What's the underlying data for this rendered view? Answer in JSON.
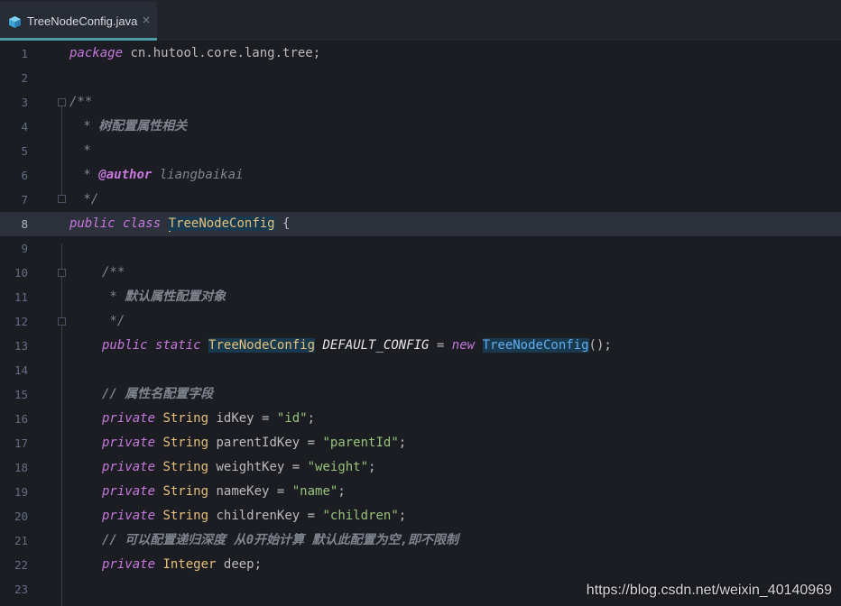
{
  "tab": {
    "filename": "TreeNodeConfig.java",
    "close_glyph": "×",
    "icon": "java-class-icon"
  },
  "line_numbers": [
    "1",
    "2",
    "3",
    "4",
    "5",
    "6",
    "7",
    "8",
    "9",
    "10",
    "11",
    "12",
    "13",
    "14",
    "15",
    "16",
    "17",
    "18",
    "19",
    "20",
    "21",
    "22",
    "23"
  ],
  "current_line": 8,
  "code": {
    "l1": {
      "kw": "package",
      "rest": " cn.hutool.core.lang.tree;"
    },
    "l3": {
      "text": "/**"
    },
    "l4": {
      "star": " * ",
      "text": "树配置属性相关"
    },
    "l5": {
      "text": " *"
    },
    "l6": {
      "star": " * ",
      "tag": "@author",
      "rest": " liangbaikai"
    },
    "l7": {
      "text": " */"
    },
    "l8": {
      "kw1": "public",
      "kw2": "class",
      "name": "TreeNodeConfig",
      "brace": " {"
    },
    "l10": {
      "text": "/**"
    },
    "l11": {
      "star": " * ",
      "text": "默认属性配置对象"
    },
    "l12": {
      "text": " */"
    },
    "l13": {
      "kw1": "public",
      "kw2": "static",
      "type": "TreeNodeConfig",
      "const": "DEFAULT_CONFIG",
      "eq": " = ",
      "kw3": "new",
      "cls": "TreeNodeConfig",
      "end": "();"
    },
    "l15": {
      "text": "// 属性名配置字段"
    },
    "l16": {
      "kw": "private",
      "type": "String",
      "name": " idKey = ",
      "str": "\"id\"",
      "end": ";"
    },
    "l17": {
      "kw": "private",
      "type": "String",
      "name": " parentIdKey = ",
      "str": "\"parentId\"",
      "end": ";"
    },
    "l18": {
      "kw": "private",
      "type": "String",
      "name": " weightKey = ",
      "str": "\"weight\"",
      "end": ";"
    },
    "l19": {
      "kw": "private",
      "type": "String",
      "name": " nameKey = ",
      "str": "\"name\"",
      "end": ";"
    },
    "l20": {
      "kw": "private",
      "type": "String",
      "name": " childrenKey = ",
      "str": "\"children\"",
      "end": ";"
    },
    "l21": {
      "text": "// 可以配置递归深度 从0开始计算 默认此配置为空,即不限制"
    },
    "l22": {
      "kw": "private",
      "type": "Integer",
      "name": " deep;"
    }
  },
  "watermark": "https://blog.csdn.net/weixin_40140969",
  "colors": {
    "background": "#1b1d23",
    "keyword": "#c678dd",
    "type": "#e5c07b",
    "string": "#98c379",
    "class_ref": "#61afef",
    "comment": "#7f848e",
    "tab_underline": "#4e9da6"
  }
}
